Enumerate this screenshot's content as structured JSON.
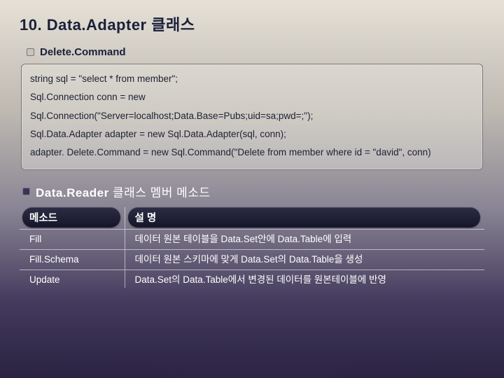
{
  "title": "10. Data.Adapter 클래스",
  "subtitle": "Delete.Command",
  "code_lines": [
    "string sql = \"select * from member\";",
    "Sql.Connection conn = new",
    "Sql.Connection(\"Server=localhost;Data.Base=Pubs;uid=sa;pwd=;\");",
    "Sql.Data.Adapter adapter = new Sql.Data.Adapter(sql, conn);",
    "adapter. Delete.Command = new Sql.Command(\"Delete from member where id = \"david\", conn)"
  ],
  "section2_bold": "Data.Reader",
  "section2_rest": " 클래스 멤버 메소드",
  "table": {
    "headers": [
      "메소드",
      "설  명"
    ],
    "rows": [
      {
        "method": "Fill",
        "desc": "데이터 원본 테이블을 Data.Set안에 Data.Table에 입력"
      },
      {
        "method": "Fill.Schema",
        "desc": "데이터 원본 스키마에 맞게 Data.Set의 Data.Table을 생성"
      },
      {
        "method": "Update",
        "desc": "Data.Set의 Data.Table에서 변경된 데이터를 원본테이블에 반영"
      }
    ]
  }
}
